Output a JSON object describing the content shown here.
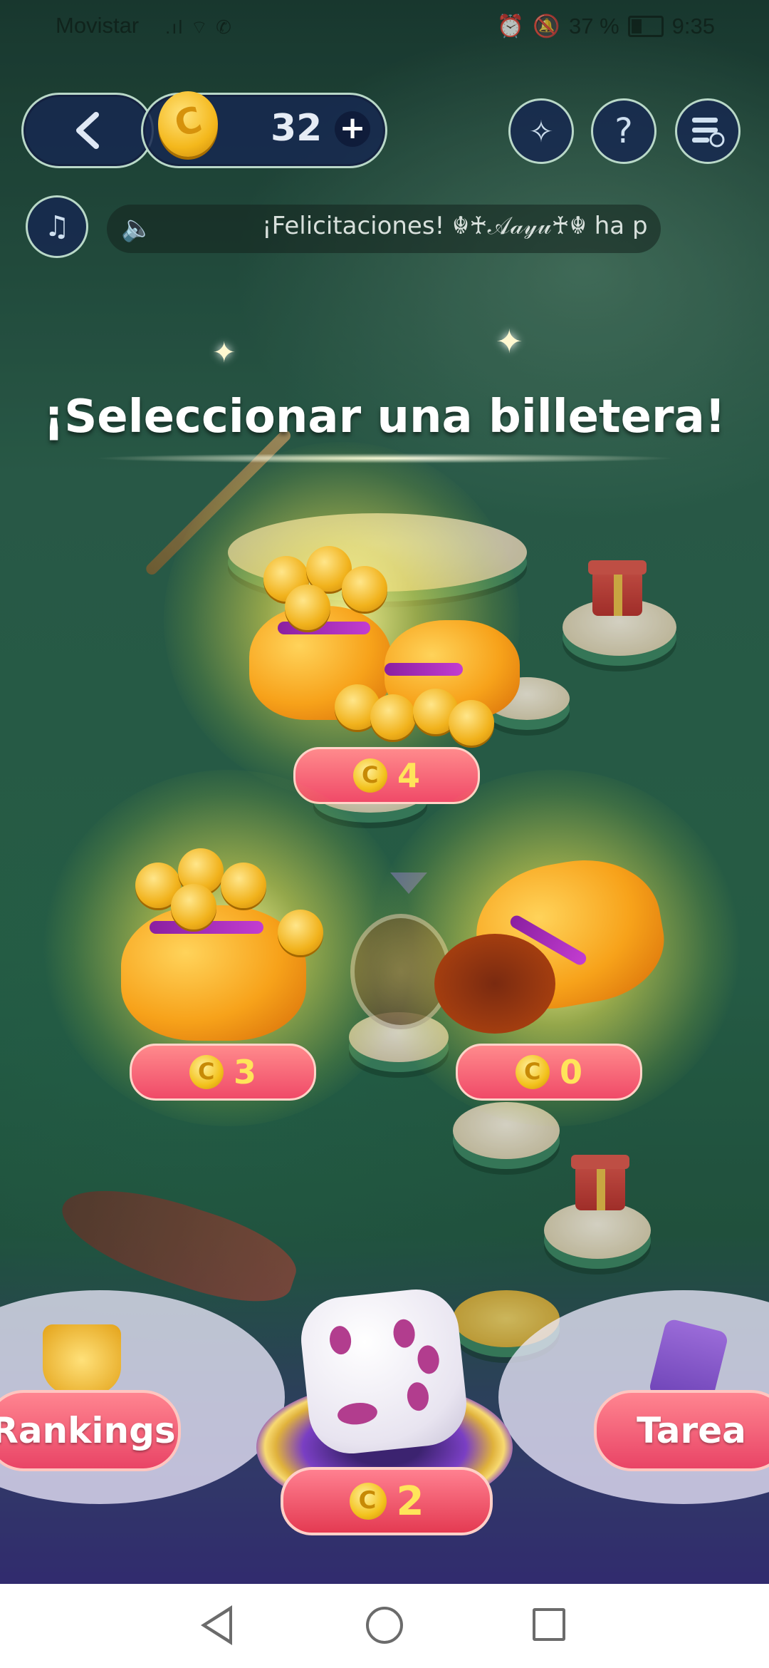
{
  "status_bar": {
    "carrier": "Movistar",
    "battery": "37 %",
    "time": "9:35"
  },
  "top_bar": {
    "coin_balance": "32",
    "plus_symbol": "+",
    "help_symbol": "?"
  },
  "ticker": {
    "text": "¡Felicitaciones! ☬♰𝒜𝒶𝓎𝓊♰☬ ha p"
  },
  "title": "¡Seleccionar una billetera!",
  "wallets": [
    {
      "value": "4"
    },
    {
      "value": "3"
    },
    {
      "value": "0"
    }
  ],
  "bottom": {
    "rankings_label": "Rankings",
    "task_label": "Tarea",
    "roll_cost": "2"
  },
  "colors": {
    "label_pink": "#f04a68",
    "coin_gold": "#f3c21d",
    "value_yellow": "#ffe45a"
  }
}
